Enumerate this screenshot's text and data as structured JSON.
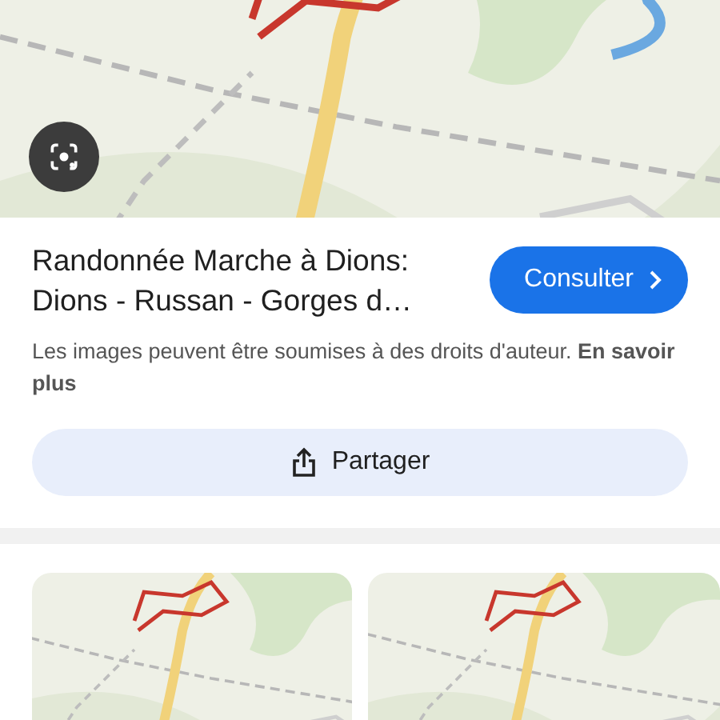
{
  "result": {
    "title": "Randonnée Marche à Dions: Dions - Russan - Gorges d…",
    "action": "Consulter"
  },
  "notice": "Les images peuvent être soumises à des droits d'auteur. **En savoir plus**",
  "share": "Partager"
}
